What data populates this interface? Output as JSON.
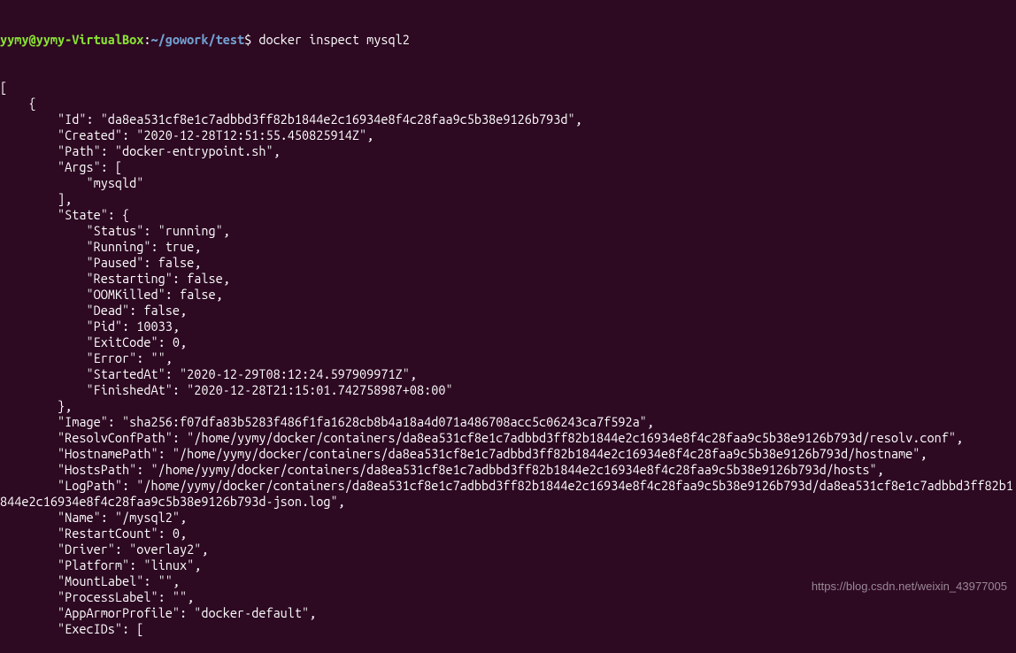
{
  "prompt": {
    "user_host": "yymy@yymy-VirtualBox",
    "colon": ":",
    "path": "~/gowork/test",
    "dollar": "$ "
  },
  "command": "docker inspect mysql2",
  "output_lines": [
    "[",
    "    {",
    "        \"Id\": \"da8ea531cf8e1c7adbbd3ff82b1844e2c16934e8f4c28faa9c5b38e9126b793d\",",
    "        \"Created\": \"2020-12-28T12:51:55.450825914Z\",",
    "        \"Path\": \"docker-entrypoint.sh\",",
    "        \"Args\": [",
    "            \"mysqld\"",
    "        ],",
    "        \"State\": {",
    "            \"Status\": \"running\",",
    "            \"Running\": true,",
    "            \"Paused\": false,",
    "            \"Restarting\": false,",
    "            \"OOMKilled\": false,",
    "            \"Dead\": false,",
    "            \"Pid\": 10033,",
    "            \"ExitCode\": 0,",
    "            \"Error\": \"\",",
    "            \"StartedAt\": \"2020-12-29T08:12:24.597909971Z\",",
    "            \"FinishedAt\": \"2020-12-28T21:15:01.742758987+08:00\"",
    "        },",
    "        \"Image\": \"sha256:f07dfa83b5283f486f1fa1628cb8b4a18a4d071a486708acc5c06243ca7f592a\",",
    "        \"ResolvConfPath\": \"/home/yymy/docker/containers/da8ea531cf8e1c7adbbd3ff82b1844e2c16934e8f4c28faa9c5b38e9126b793d/resolv.conf\",",
    "        \"HostnamePath\": \"/home/yymy/docker/containers/da8ea531cf8e1c7adbbd3ff82b1844e2c16934e8f4c28faa9c5b38e9126b793d/hostname\",",
    "        \"HostsPath\": \"/home/yymy/docker/containers/da8ea531cf8e1c7adbbd3ff82b1844e2c16934e8f4c28faa9c5b38e9126b793d/hosts\",",
    "        \"LogPath\": \"/home/yymy/docker/containers/da8ea531cf8e1c7adbbd3ff82b1844e2c16934e8f4c28faa9c5b38e9126b793d/da8ea531cf8e1c7adbbd3ff82b1844e2c16934e8f4c28faa9c5b38e9126b793d-json.log\",",
    "        \"Name\": \"/mysql2\",",
    "        \"RestartCount\": 0,",
    "        \"Driver\": \"overlay2\",",
    "        \"Platform\": \"linux\",",
    "        \"MountLabel\": \"\",",
    "        \"ProcessLabel\": \"\",",
    "        \"AppArmorProfile\": \"docker-default\",",
    "        \"ExecIDs\": ["
  ],
  "watermark": "https://blog.csdn.net/weixin_43977005"
}
